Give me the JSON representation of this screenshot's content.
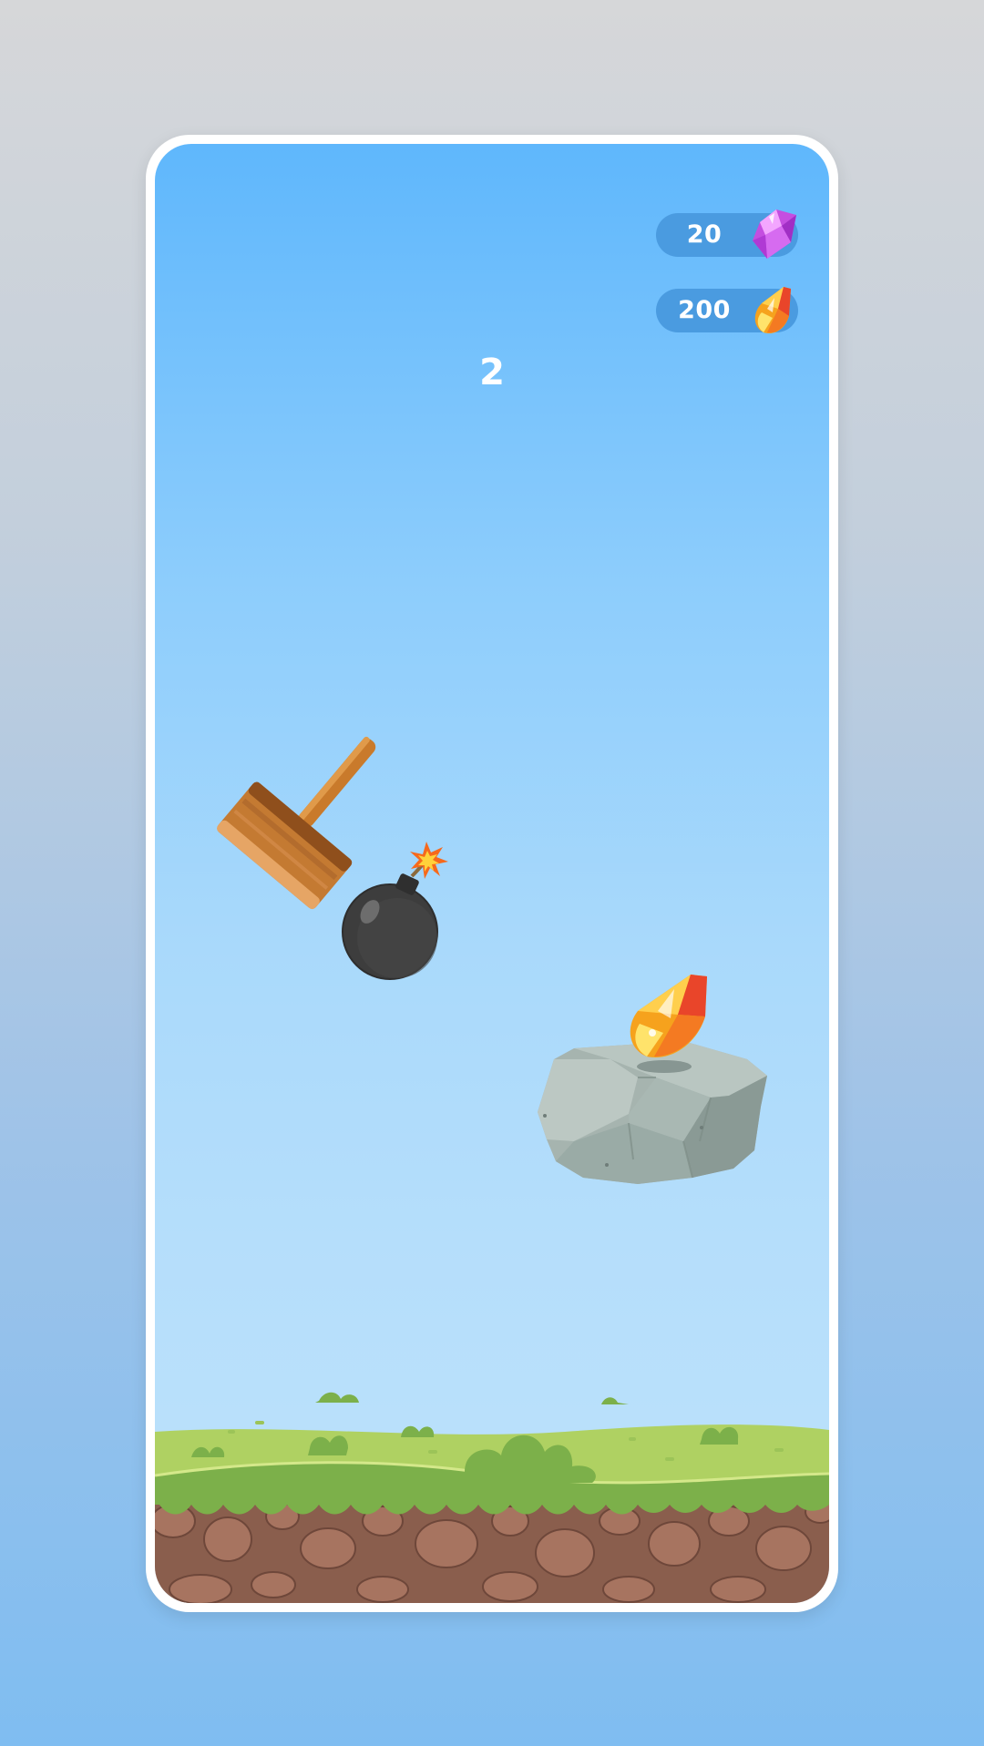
{
  "hud": {
    "gem_count": "20",
    "crystal_count": "200",
    "score": "2"
  },
  "icons": {
    "gem": "pink-gem-icon",
    "crystal": "fire-crystal-icon"
  },
  "colors": {
    "sky_top": "#5fb7fc",
    "sky_bottom": "#bde2fb",
    "pill": "#4a9be0",
    "grass": "#afd162",
    "dirt": "#8a5e4d"
  }
}
